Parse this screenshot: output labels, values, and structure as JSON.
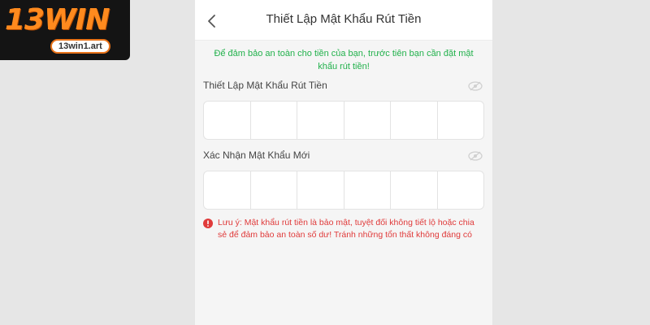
{
  "brand": {
    "logo_text": "13WIN",
    "site": "13win1.art",
    "colors": {
      "orange": "#ff8a1e",
      "dark": "#141414"
    }
  },
  "header": {
    "title": "Thiết Lập Mật Khẩu Rút Tiền",
    "back_icon": "chevron-left-icon"
  },
  "notice": "Để đảm bảo an toàn cho tiền của bạn, trước tiên bạn cần đặt mật khẩu rút tiền!",
  "fields": [
    {
      "label": "Thiết Lập Mật Khẩu Rút Tiền",
      "digits": [
        "",
        "",
        "",
        "",
        "",
        ""
      ],
      "toggle_icon": "eye-hidden-icon"
    },
    {
      "label": "Xác Nhận Mật Khẩu Mới",
      "digits": [
        "",
        "",
        "",
        "",
        "",
        ""
      ],
      "toggle_icon": "eye-hidden-icon"
    }
  ],
  "warning": {
    "icon": "alert-circle-icon",
    "text": "Lưu ý: Mật khẩu rút tiền là bảo mật, tuyệt đối không tiết lộ hoặc chia sẻ để đảm bảo an toàn số dư! Tránh những tổn thất không đáng có"
  },
  "colors": {
    "notice": "#22b14c",
    "warning": "#e03a3a",
    "background": "#f5f5f5"
  }
}
